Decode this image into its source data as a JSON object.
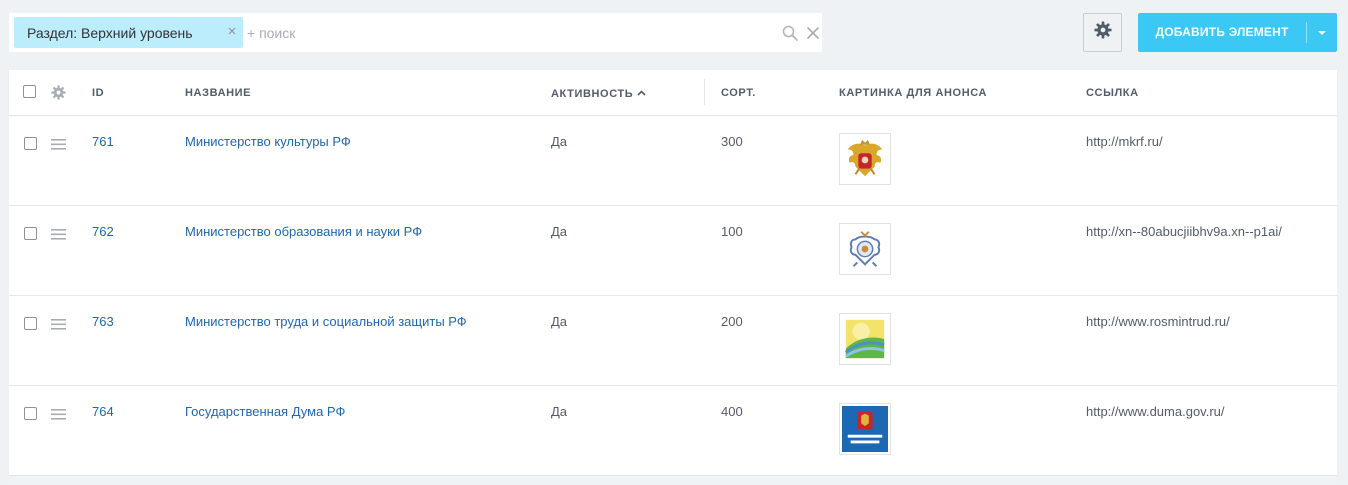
{
  "filter": {
    "tag_label": "Раздел: Верхний уровень",
    "tag_close": "×",
    "search_placeholder": "+ поиск",
    "search_value": ""
  },
  "toolbar": {
    "add_label": "ДОБАВИТЬ ЭЛЕМЕНТ"
  },
  "columns": {
    "id": "ID",
    "name": "НАЗВАНИЕ",
    "active": "АКТИВНОСТЬ",
    "sort": "СОРТ.",
    "picture": "КАРТИНКА ДЛЯ АНОНСА",
    "link": "ССЫЛКА"
  },
  "rows": [
    {
      "id": "761",
      "name": "Министерство культуры РФ",
      "active": "Да",
      "sort": "300",
      "picture": "coat-of-arms",
      "link": "http://mkrf.ru/"
    },
    {
      "id": "762",
      "name": "Министерство образования и науки РФ",
      "active": "Да",
      "sort": "100",
      "picture": "education-emblem",
      "link": "http://xn--80abucjiibhv9a.xn--p1ai/"
    },
    {
      "id": "763",
      "name": "Министерство труда и социальной защиты РФ",
      "active": "Да",
      "sort": "200",
      "picture": "labor-emblem",
      "link": "http://www.rosmintrud.ru/"
    },
    {
      "id": "764",
      "name": "Государственная Дума РФ",
      "active": "Да",
      "sort": "400",
      "picture": "duma-logo",
      "link": "http://www.duma.gov.ru/"
    }
  ],
  "colors": {
    "accent": "#3bc8f5",
    "link": "#2067b0",
    "tag": "#bcedfc"
  }
}
